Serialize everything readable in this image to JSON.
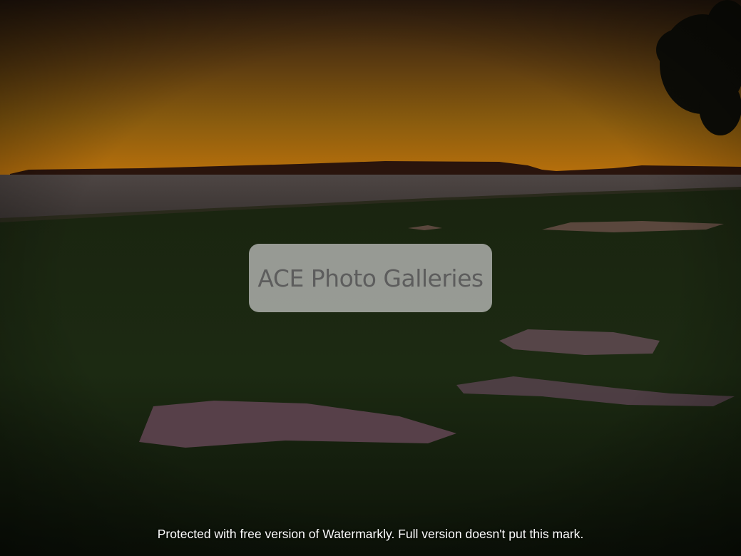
{
  "photo": {
    "subject": "sunset-over-lake-with-grass-and-puddles",
    "colors": {
      "sky_top": "#2a1a0e",
      "sky_mid": "#8a5a10",
      "sky_horizon": "#c07a0c",
      "island": "#2a140c",
      "water": "#4a4240",
      "grass_dark": "#0e160a",
      "grass_mid": "#1e2c12",
      "puddle": "#6a4a55"
    }
  },
  "watermark": {
    "brand_text": "ACE Photo Galleries"
  },
  "footer": {
    "notice": "Protected with free version of Watermarkly. Full version doesn't put this mark."
  }
}
